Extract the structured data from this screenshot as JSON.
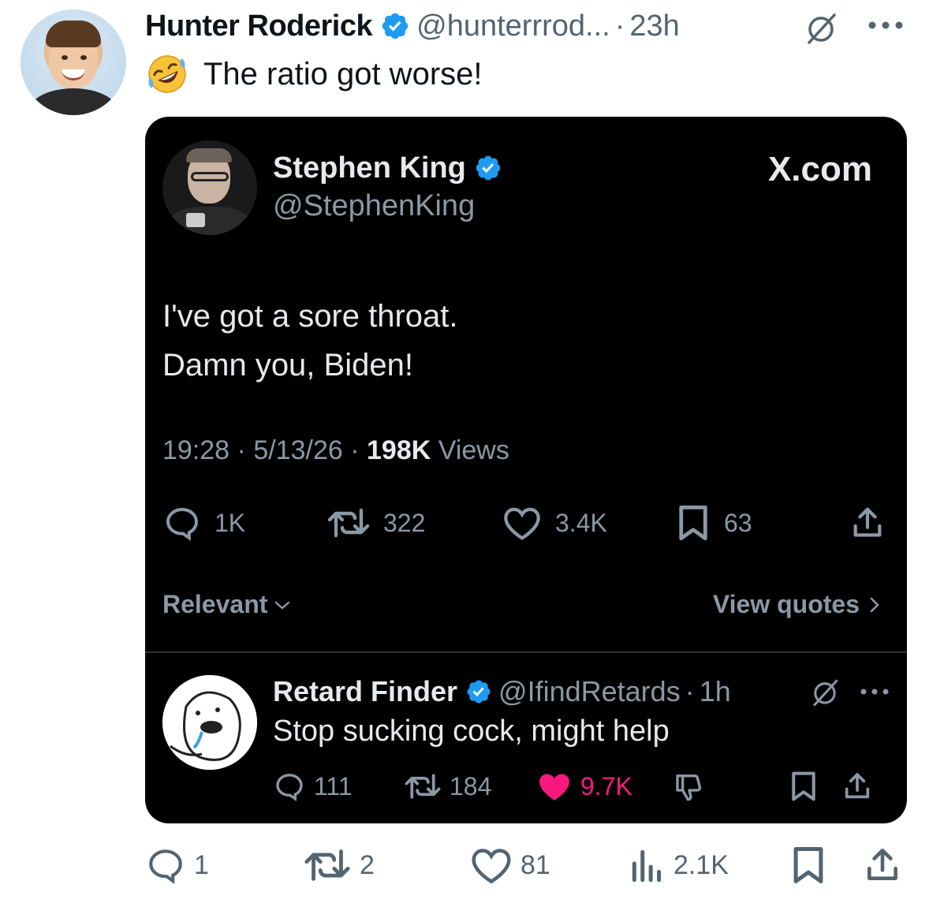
{
  "author": {
    "name": "Hunter Roderick",
    "handle": "@hunterrrod...",
    "separator": "·",
    "time": "23h"
  },
  "tweet_text": "The ratio got worse!",
  "embedded": {
    "author_name": "Stephen King",
    "author_handle": "@StephenKing",
    "site_label": "X.com",
    "text_line1": "I've got a sore throat.",
    "text_line2": "Damn you, Biden!",
    "time": "19:28",
    "date": "5/13/26",
    "meta_sep": "·",
    "views_count": "198K",
    "views_label": "Views",
    "replies": "1K",
    "retweets": "322",
    "likes": "3.4K",
    "bookmarks": "63",
    "sort_label": "Relevant",
    "view_quotes_label": "View quotes",
    "reply": {
      "name": "Retard Finder",
      "handle": "@IfindRetards",
      "separator": "·",
      "time": "1h",
      "text": "Stop sucking cock, might help",
      "replies": "111",
      "retweets": "184",
      "likes": "9.7K"
    }
  },
  "actions": {
    "replies": "1",
    "retweets": "2",
    "likes": "81",
    "views": "2.1K"
  },
  "colors": {
    "verified": "#1d9bf0",
    "like_active": "#f91880",
    "muted_light": "#536471",
    "muted_dark": "#8b98a5"
  },
  "icons": [
    "verified-badge-icon",
    "grok-icon",
    "more-icon",
    "rofl-emoji",
    "reply-icon",
    "retweet-icon",
    "heart-icon",
    "bookmark-icon",
    "share-icon",
    "views-icon",
    "dislike-icon",
    "chevron-down-icon",
    "chevron-right-icon"
  ]
}
